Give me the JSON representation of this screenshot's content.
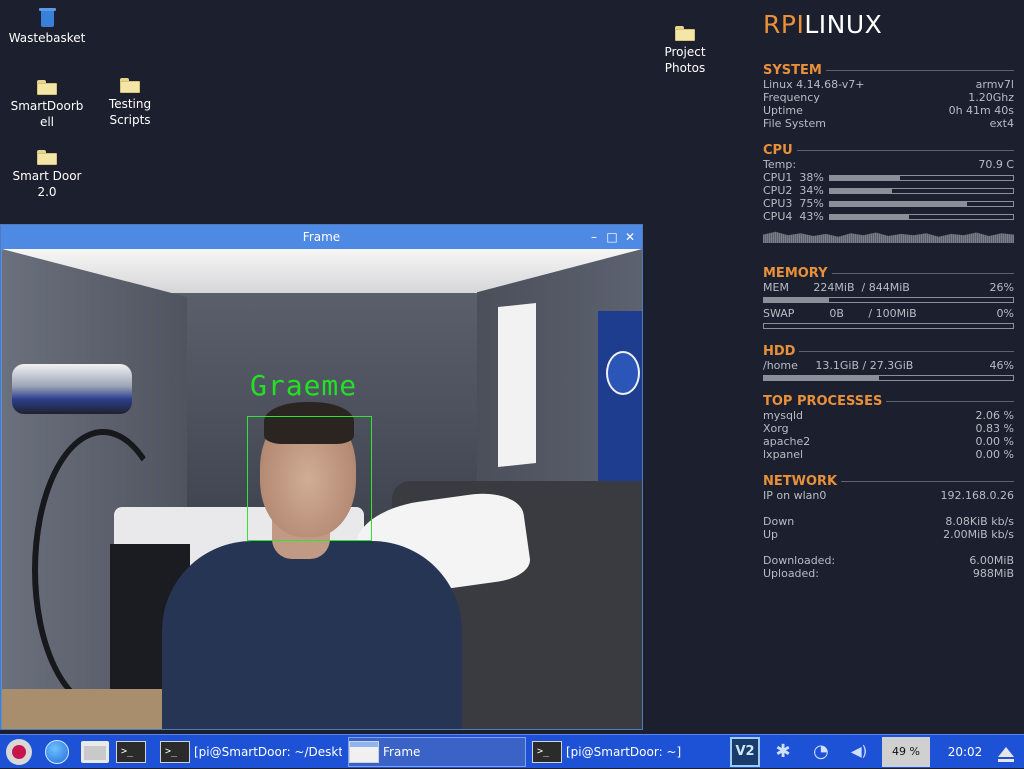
{
  "desktop": {
    "icons": [
      {
        "label": "Wastebasket",
        "icon": "trash-icon"
      },
      {
        "label": "SmartDoorbell",
        "icon": "folder-icon"
      },
      {
        "label": "Testing Scripts",
        "icon": "folder-icon"
      },
      {
        "label": "Smart Door 2.0",
        "icon": "folder-icon"
      },
      {
        "label": "Project Photos",
        "icon": "folder-icon"
      }
    ]
  },
  "frame_window": {
    "title": "Frame",
    "controls": {
      "minimize": "–",
      "maximize": "□",
      "close": "✕"
    },
    "detection": {
      "name": "Graeme",
      "box_color": "#2ee62e"
    }
  },
  "conky": {
    "brand_a": "RPI",
    "brand_b": "LINUX",
    "accent_color": "#e8903a",
    "system": {
      "title": "SYSTEM",
      "rows": [
        {
          "label": "Linux 4.14.68-v7+",
          "value": "armv7l"
        },
        {
          "label": "Frequency",
          "value": "1.20Ghz"
        },
        {
          "label": "Uptime",
          "value": "0h 41m 40s"
        },
        {
          "label": "File System",
          "value": "ext4"
        }
      ]
    },
    "cpu": {
      "title": "CPU",
      "temp_label": "Temp:",
      "temp_value": "70.9 C",
      "cores": [
        {
          "label": "CPU1",
          "percent_text": "38%",
          "percent": 38
        },
        {
          "label": "CPU2",
          "percent_text": "34%",
          "percent": 34
        },
        {
          "label": "CPU3",
          "percent_text": "75%",
          "percent": 75
        },
        {
          "label": "CPU4",
          "percent_text": "43%",
          "percent": 43
        }
      ]
    },
    "memory": {
      "title": "MEMORY",
      "mem": {
        "label": "MEM",
        "used": "224MiB",
        "total": "/ 844MiB",
        "percent_text": "26%",
        "percent": 26
      },
      "swap": {
        "label": "SWAP",
        "used": "0B",
        "total": "/ 100MiB",
        "percent_text": "0%",
        "percent": 0
      }
    },
    "hdd": {
      "title": "HDD",
      "label": "/home",
      "usage": "13.1GiB / 27.3GiB",
      "percent_text": "46%",
      "percent": 46
    },
    "processes": {
      "title": "TOP PROCESSES",
      "rows": [
        {
          "name": "mysqld",
          "value": "2.06 %"
        },
        {
          "name": "Xorg",
          "value": "0.83 %"
        },
        {
          "name": "apache2",
          "value": "0.00 %"
        },
        {
          "name": "lxpanel",
          "value": "0.00 %"
        }
      ]
    },
    "network": {
      "title": "NETWORK",
      "ip_label": "IP on wlan0",
      "ip_value": "192.168.0.26",
      "down_label": "Down",
      "down_value": "8.08KiB kb/s",
      "up_label": "Up",
      "up_value": "2.00MiB kb/s",
      "downloaded_label": "Downloaded:",
      "downloaded_value": "6.00MiB",
      "uploaded_label": "Uploaded:",
      "uploaded_value": "988MiB"
    }
  },
  "taskbar": {
    "launchers": [
      {
        "name": "raspberry-menu-icon"
      },
      {
        "name": "web-browser-icon"
      },
      {
        "name": "file-manager-icon"
      },
      {
        "name": "terminal-icon",
        "glyph": ">_"
      }
    ],
    "tasks": [
      {
        "label": "[pi@SmartDoor: ~/Deskto...",
        "icon": "terminal-icon",
        "glyph": ">_",
        "active": false
      },
      {
        "label": "Frame",
        "icon": "window-icon",
        "active": true
      },
      {
        "label": "[pi@SmartDoor: ~]",
        "icon": "terminal-icon",
        "glyph": ">_",
        "active": false
      }
    ],
    "tray": {
      "vnc": "V2",
      "bluetooth_glyph": "✱",
      "wifi_glyph": "◔",
      "volume_glyph": "◀)",
      "cpu_usage": "49 %",
      "clock": "20:02"
    }
  }
}
